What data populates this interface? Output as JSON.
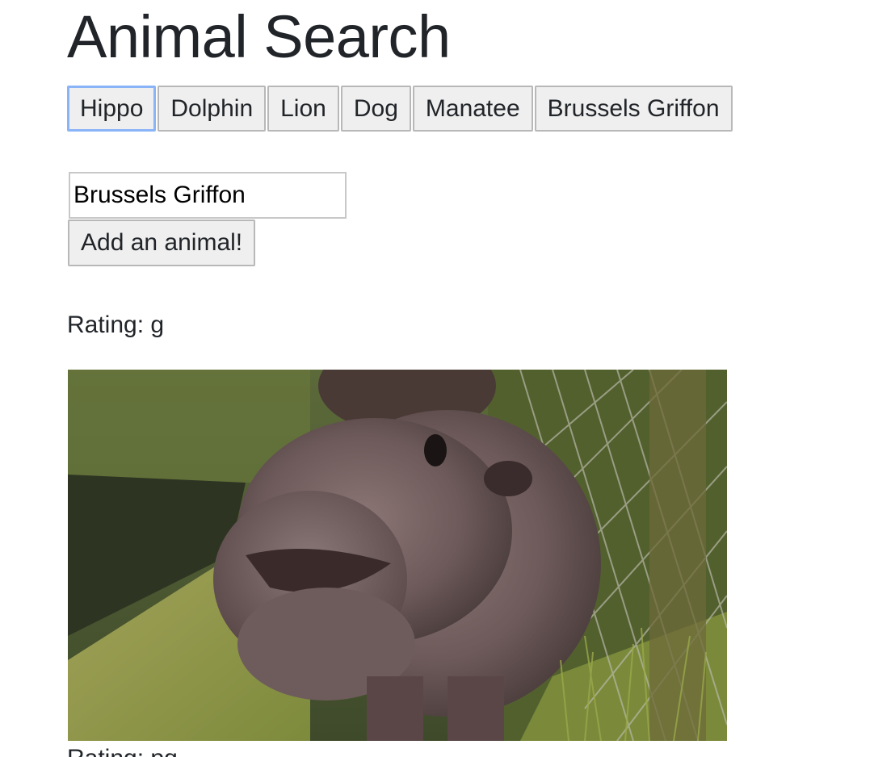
{
  "header": {
    "title": "Animal Search"
  },
  "animal_buttons": [
    {
      "label": "Hippo"
    },
    {
      "label": "Dolphin"
    },
    {
      "label": "Lion"
    },
    {
      "label": "Dog"
    },
    {
      "label": "Manatee"
    },
    {
      "label": "Brussels Griffon"
    }
  ],
  "form": {
    "input_value": "Brussels Griffon",
    "add_button_label": "Add an animal!"
  },
  "results": [
    {
      "rating_text": "Rating: g",
      "image": "hippo-gif"
    },
    {
      "rating_text": "Rating: pg"
    }
  ],
  "colors": {
    "text": "#212529",
    "button_bg": "#efefef",
    "button_border": "#b8b8b8",
    "focus_ring": "#8ab4f8"
  }
}
